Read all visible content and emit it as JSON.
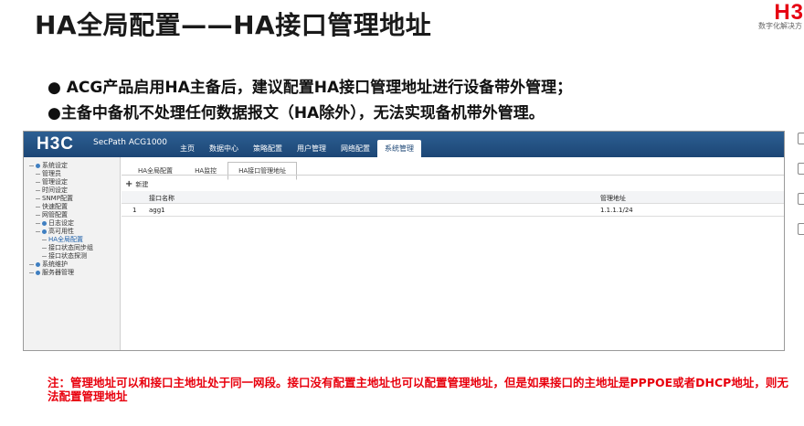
{
  "slide": {
    "title": "HA全局配置——HA接口管理地址",
    "brand": "H3",
    "brand_tagline": "数字化解决方",
    "bullets": [
      "● ACG产品启用HA主备后，建议配置HA接口管理地址进行设备带外管理；",
      "●主备中备机不处理任何数据报文（HA除外），无法实现备机带外管理。"
    ],
    "note": "注：管理地址可以和接口主地址处于同一网段。接口没有配置主地址也可以配置管理地址，但是如果接口的主地址是PPPOE或者DHCP地址，则无法配置管理地址"
  },
  "app": {
    "logo": "H3C",
    "product": "SecPath ACG1000",
    "nav": [
      "主页",
      "数据中心",
      "策略配置",
      "用户管理",
      "网络配置",
      "系统管理"
    ],
    "active_nav": "系统管理",
    "sidebar": [
      {
        "label": "系统设定",
        "level": 0,
        "icon": true
      },
      {
        "label": "管理员",
        "level": 1
      },
      {
        "label": "管理设定",
        "level": 1
      },
      {
        "label": "时间设定",
        "level": 1
      },
      {
        "label": "SNMP配置",
        "level": 1
      },
      {
        "label": "快速配置",
        "level": 1
      },
      {
        "label": "网管配置",
        "level": 1
      },
      {
        "label": "日志设定",
        "level": 1,
        "icon": true
      },
      {
        "label": "高可用性",
        "level": 1,
        "icon": true
      },
      {
        "label": "HA全局配置",
        "level": 2,
        "selected": true
      },
      {
        "label": "接口状态同步组",
        "level": 2
      },
      {
        "label": "接口状态探测",
        "level": 2
      },
      {
        "label": "系统维护",
        "level": 0,
        "icon": true
      },
      {
        "label": "服务器管理",
        "level": 0,
        "icon": true
      }
    ],
    "tabs": [
      "HA全局配置",
      "HA监控",
      "HA接口管理地址"
    ],
    "active_tab": "HA接口管理地址",
    "new_label": "新建",
    "table": {
      "headers": [
        "接口名称",
        "管理地址"
      ],
      "rows": [
        {
          "index": "1",
          "name": "agg1",
          "address": "1.1.1.1/24"
        }
      ]
    }
  }
}
